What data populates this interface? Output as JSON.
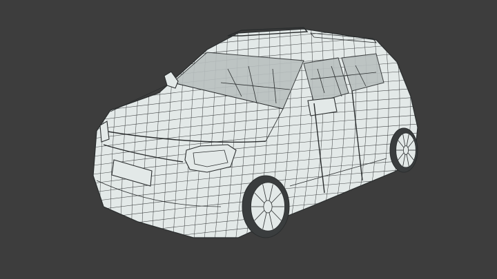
{
  "scene": {
    "background_color": "#3d3d3d",
    "mesh_fill_color": "#e3e9e8",
    "mesh_line_color": "#2a2d2e",
    "glass_color": "#b9c0c0",
    "subject": "car-wireframe-icon"
  }
}
